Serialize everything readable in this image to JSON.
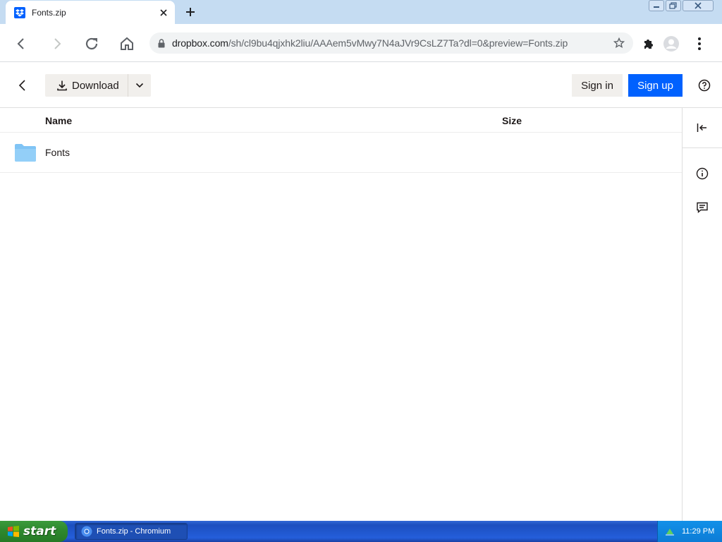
{
  "browser": {
    "tab_title": "Fonts.zip",
    "url_domain": "dropbox.com",
    "url_path": "/sh/cl9bu4qjxhk2liu/AAAem5vMwy7N4aJVr9CsLZ7Ta?dl=0&preview=Fonts.zip"
  },
  "header": {
    "download_label": "Download",
    "signin_label": "Sign in",
    "signup_label": "Sign up"
  },
  "list": {
    "col_name": "Name",
    "col_size": "Size",
    "rows": [
      {
        "name": "Fonts",
        "size": ""
      }
    ]
  },
  "taskbar": {
    "start_label": "start",
    "task_label": "Fonts.zip - Chromium",
    "clock": "11:29 PM"
  },
  "colors": {
    "accent": "#0061fe",
    "folder": "#80c4f5"
  }
}
